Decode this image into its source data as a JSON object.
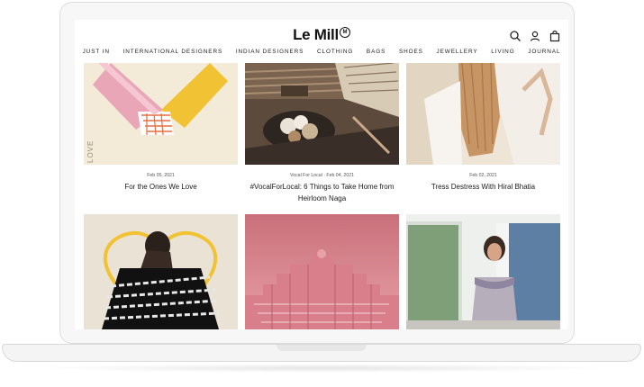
{
  "brand": {
    "logo_text": "Le Mill",
    "logo_mark": "M"
  },
  "header_icons": [
    "search-icon",
    "account-icon",
    "bag-icon"
  ],
  "nav": [
    {
      "label": "JUST IN"
    },
    {
      "label": "INTERNATIONAL DESIGNERS"
    },
    {
      "label": "INDIAN DESIGNERS"
    },
    {
      "label": "CLOTHING"
    },
    {
      "label": "BAGS"
    },
    {
      "label": "SHOES"
    },
    {
      "label": "JEWELLERY"
    },
    {
      "label": "LIVING"
    },
    {
      "label": "JOURNAL"
    }
  ],
  "posts": [
    {
      "meta": "Feb 05, 2021",
      "title": "For the Ones We Love",
      "image_text": "LOVE"
    },
    {
      "meta": "Vocal For Local · Feb 04, 2021",
      "title": "#VocalForLocal: 6 Things to Take Home from Heirloom Naga"
    },
    {
      "meta": "Feb 02, 2021",
      "title": "Tress Destress With Hiral Bhatia"
    },
    {
      "meta": "",
      "title": ""
    },
    {
      "meta": "",
      "title": ""
    },
    {
      "meta": "",
      "title": ""
    }
  ],
  "colors": {
    "text": "#1a1a1a",
    "muted": "#555555",
    "frame": "#f7f7f7",
    "love_bg": "#f3ead7",
    "heart_yellow": "#f1c233",
    "pink_sky": "#d98a93",
    "palace": "#c9707b"
  }
}
